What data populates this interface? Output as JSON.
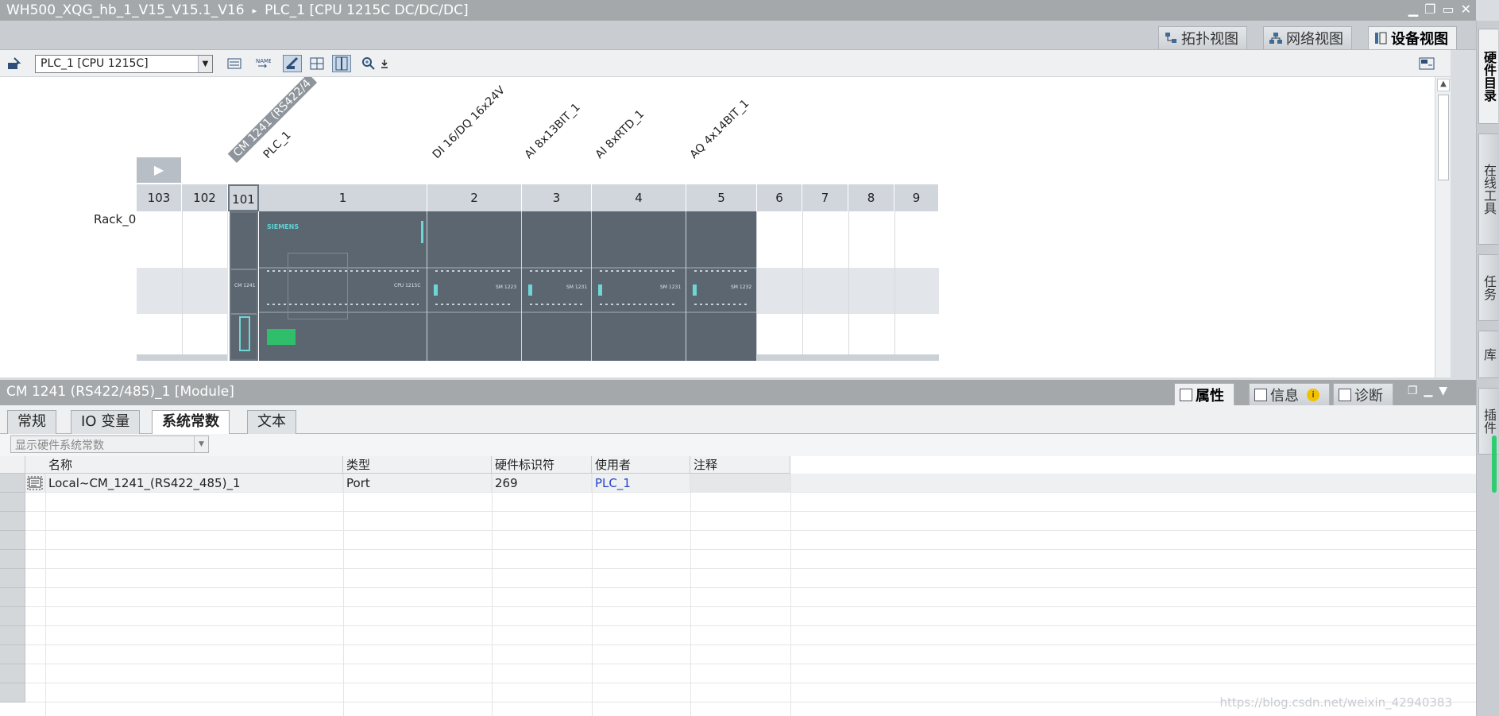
{
  "window": {
    "project": "WH500_XQG_hb_1_V15_V15.1_V16",
    "device": "PLC_1 [CPU 1215C DC/DC/DC]",
    "separator": "▸"
  },
  "view_tabs": [
    {
      "label": "拓扑视图",
      "active": false
    },
    {
      "label": "网络视图",
      "active": false
    },
    {
      "label": "设备视图",
      "active": true
    }
  ],
  "toolbar": {
    "device_select": "PLC_1 [CPU 1215C]"
  },
  "canvas": {
    "rack_name": "Rack_0",
    "module_labels": [
      {
        "text": "CM 1241 (RS422/4",
        "highlighted": true
      },
      {
        "text": "PLC_1",
        "highlighted": false
      },
      {
        "text": "DI 16/DQ 16x24V",
        "highlighted": false
      },
      {
        "text": "AI 8x13BIT_1",
        "highlighted": false
      },
      {
        "text": "AI 8xRTD_1",
        "highlighted": false
      },
      {
        "text": "AQ 4x14BIT_1",
        "highlighted": false
      }
    ],
    "slots": [
      "103",
      "102",
      "101",
      "1",
      "2",
      "3",
      "4",
      "5",
      "6",
      "7",
      "8",
      "9"
    ],
    "selected_slot": "101",
    "brand": "SIEMENS"
  },
  "properties": {
    "title": "CM 1241 (RS422/485)_1 [Module]",
    "tabs": [
      {
        "label": "属性",
        "active": true
      },
      {
        "label": "信息",
        "active": false
      },
      {
        "label": "诊断",
        "active": false
      }
    ],
    "subtabs": [
      {
        "label": "常规",
        "active": false
      },
      {
        "label": "IO 变量",
        "active": false
      },
      {
        "label": "系统常数",
        "active": true
      },
      {
        "label": "文本",
        "active": false
      }
    ],
    "filter": "显示硬件系统常数",
    "columns": [
      "名称",
      "类型",
      "硬件标识符",
      "使用者",
      "注释"
    ],
    "rows": [
      {
        "name": "Local~CM_1241_(RS422_485)_1",
        "type": "Port",
        "hwid": "269",
        "user": "PLC_1",
        "comment": ""
      }
    ]
  },
  "right_cards": [
    {
      "label": "硬件目录",
      "active": true
    },
    {
      "label": "在线工具",
      "active": false
    },
    {
      "label": "任务",
      "active": false
    },
    {
      "label": "库",
      "active": false
    },
    {
      "label": "插件",
      "active": false
    }
  ],
  "watermark": "https://blog.csdn.net/weixin_42940383"
}
